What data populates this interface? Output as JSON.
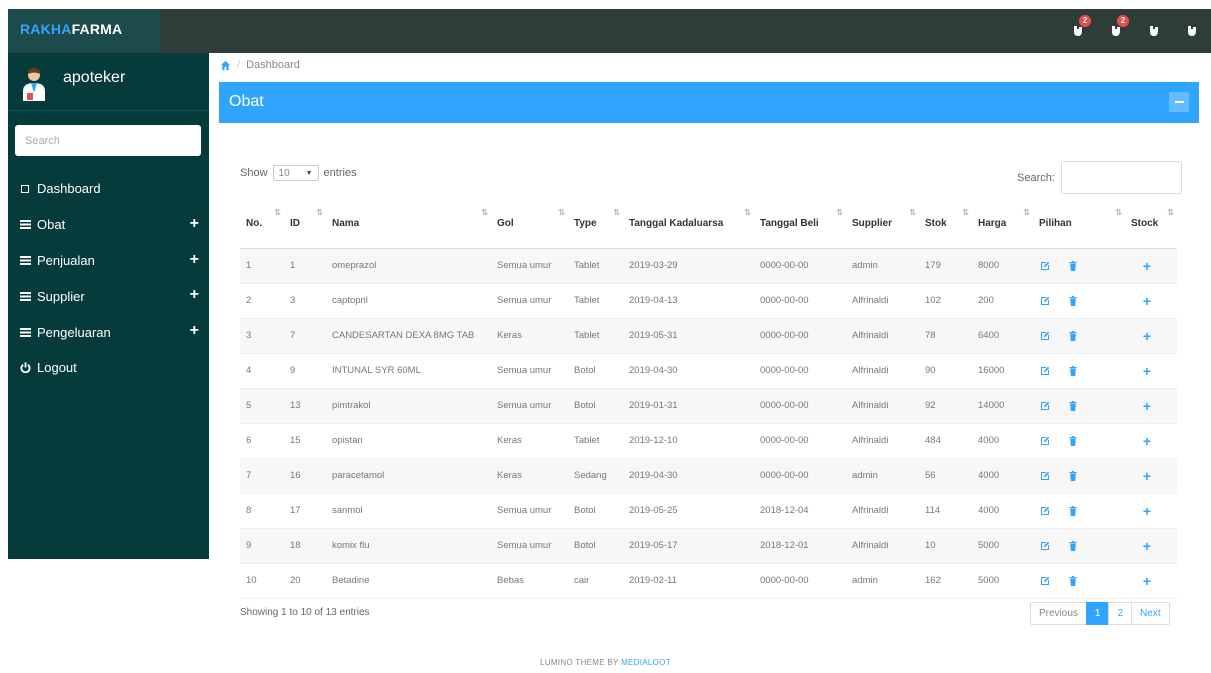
{
  "brand": {
    "part1": "RAKHA",
    "part2": "FARMA"
  },
  "navbar": {
    "icons": [
      {
        "name": "notification-icon",
        "badge": "2"
      },
      {
        "name": "notification-icon",
        "badge": "2"
      },
      {
        "name": "notification-icon",
        "badge": ""
      },
      {
        "name": "notification-icon",
        "badge": ""
      }
    ]
  },
  "sidebar": {
    "username": "apoteker",
    "search_placeholder": "Search",
    "items": [
      {
        "label": "Dashboard",
        "icon": "square-icon",
        "expandable": false
      },
      {
        "label": "Obat",
        "icon": "bars-icon",
        "expandable": true
      },
      {
        "label": "Penjualan",
        "icon": "bars-icon",
        "expandable": true
      },
      {
        "label": "Supplier",
        "icon": "bars-icon",
        "expandable": true
      },
      {
        "label": "Pengeluaran",
        "icon": "bars-icon",
        "expandable": true
      },
      {
        "label": "Logout",
        "icon": "power-icon",
        "expandable": false
      }
    ],
    "expand_symbol": "+"
  },
  "breadcrumb": {
    "current": "Dashboard"
  },
  "panel": {
    "title": "Obat"
  },
  "table_controls": {
    "show_label": "Show",
    "entries_value": "10",
    "entries_label": "entries",
    "search_label": "Search:"
  },
  "table": {
    "columns": [
      "No.",
      "ID",
      "Nama",
      "Gol",
      "Type",
      "Tanggal Kadaluarsa",
      "Tanggal Beli",
      "Supplier",
      "Stok",
      "Harga",
      "Pilihan",
      "Stock"
    ],
    "rows": [
      [
        "1",
        "1",
        "omeprazol",
        "Semua umur",
        "Tablet",
        "2019-03-29",
        "0000-00-00",
        "admin",
        "179",
        "8000"
      ],
      [
        "2",
        "3",
        "captopril",
        "Semua umur",
        "Tablet",
        "2019-04-13",
        "0000-00-00",
        "Alfrinaldi",
        "102",
        "200"
      ],
      [
        "3",
        "7",
        "CANDESARTAN DEXA 8MG TAB",
        "Keras",
        "Tablet",
        "2019-05-31",
        "0000-00-00",
        "Alfrinaldi",
        "78",
        "6400"
      ],
      [
        "4",
        "9",
        "INTUNAL SYR 60ML",
        "Semua umur",
        "Botol",
        "2019-04-30",
        "0000-00-00",
        "Alfrinaldi",
        "90",
        "16000"
      ],
      [
        "5",
        "13",
        "pimtrakol",
        "Semua umur",
        "Botol",
        "2019-01-31",
        "0000-00-00",
        "Alfrinaldi",
        "92",
        "14000"
      ],
      [
        "6",
        "15",
        "opistan",
        "Keras",
        "Tablet",
        "2019-12-10",
        "0000-00-00",
        "Alfrinaldi",
        "484",
        "4000"
      ],
      [
        "7",
        "16",
        "paracetamol",
        "Keras",
        "Sedang",
        "2019-04-30",
        "0000-00-00",
        "admin",
        "56",
        "4000"
      ],
      [
        "8",
        "17",
        "sanmol",
        "Semua umur",
        "Botol",
        "2019-05-25",
        "2018-12-04",
        "Alfrinaldi",
        "114",
        "4000"
      ],
      [
        "9",
        "18",
        "komix flu",
        "Semua umur",
        "Botol",
        "2019-05-17",
        "2018-12-01",
        "Alfrinaldi",
        "10",
        "5000"
      ],
      [
        "10",
        "20",
        "Betadine",
        "Bebas",
        "cair",
        "2019-02-11",
        "0000-00-00",
        "admin",
        "162",
        "5000"
      ]
    ],
    "add_symbol": "+"
  },
  "table_info": "Showing 1 to 10 of 13 entries",
  "pagination": {
    "previous": "Previous",
    "pages": [
      "1",
      "2"
    ],
    "active": "1",
    "next": "Next"
  },
  "footer": {
    "prefix": "LUMINO THEME BY ",
    "highlight": "MEDIALOOT"
  },
  "colors": {
    "accent": "#30a5ff",
    "sidebar": "#063b3b",
    "navbar": "#2f3d3a",
    "badge": "#e84d4d"
  }
}
